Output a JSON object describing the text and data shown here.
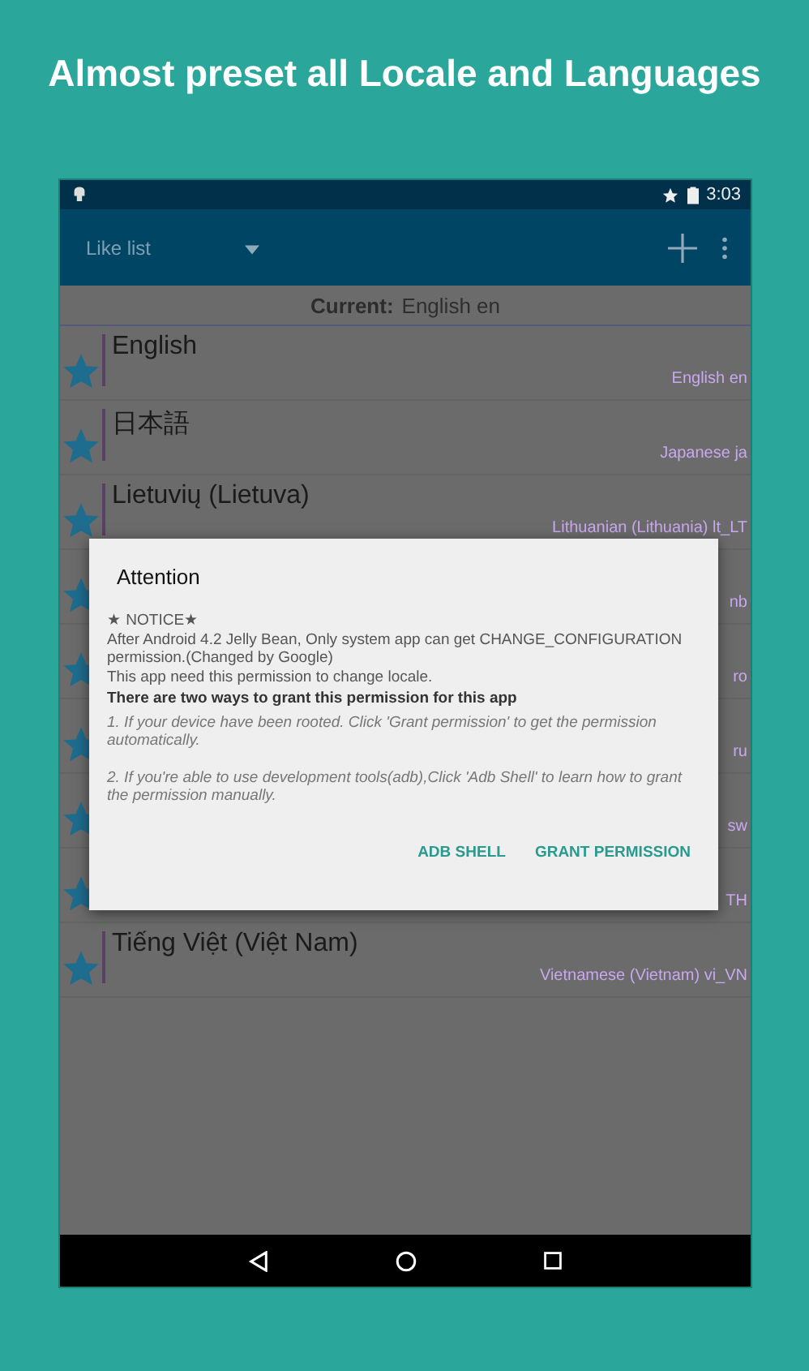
{
  "headline": "Almost preset all Locale and Languages",
  "status_bar": {
    "time": "3:03"
  },
  "toolbar": {
    "title": "Like list"
  },
  "current": {
    "label": "Current:",
    "value": "English en"
  },
  "rows": [
    {
      "name": "English",
      "subtitle": "English en",
      "starred": true
    },
    {
      "name": "日本語",
      "subtitle": "Japanese ja",
      "starred": true
    },
    {
      "name": "Lietuvių (Lietuva)",
      "subtitle": "Lithuanian (Lithuania) lt_LT",
      "starred": true
    },
    {
      "subtitle": "nb",
      "starred": true
    },
    {
      "subtitle": "ro",
      "starred": true
    },
    {
      "subtitle": "ru",
      "starred": true
    },
    {
      "subtitle": "sw",
      "starred": true
    },
    {
      "subtitle": "TH",
      "starred": true
    },
    {
      "name": "Tiếng Việt (Việt Nam)",
      "subtitle": "Vietnamese (Vietnam) vi_VN",
      "starred": true
    }
  ],
  "dialog": {
    "title": "Attention",
    "paragraphs": [
      {
        "kind": "plain",
        "text": "★ NOTICE★"
      },
      {
        "kind": "plain",
        "text": "After Android 4.2 Jelly Bean, Only system app can get CHANGE_CONFIGURATION permission.(Changed by Google)"
      },
      {
        "kind": "plain",
        "text": "This app need this permission to change locale."
      },
      {
        "kind": "heading",
        "text": "There are two ways to grant this permission for this app"
      },
      {
        "kind": "note",
        "text": "1. If your device have been rooted. Click 'Grant permission' to get the permission automatically."
      },
      {
        "kind": "note",
        "text": "2. If you're able to use development tools(adb),Click 'Adb Shell' to learn how to grant the permission manually."
      }
    ],
    "buttons": [
      "ADB SHELL",
      "GRANT PERMISSION"
    ]
  }
}
